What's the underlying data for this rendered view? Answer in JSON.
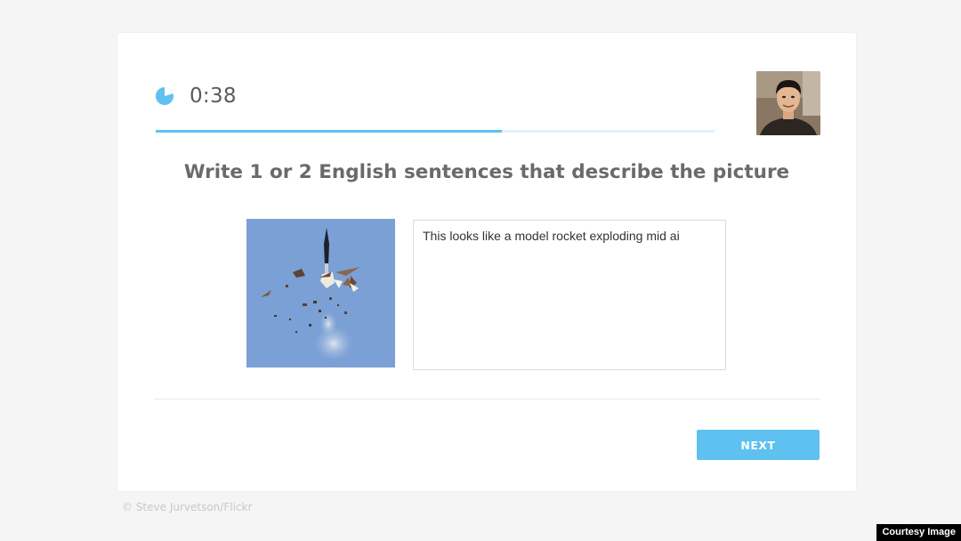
{
  "timer": {
    "remaining": "0:38",
    "progress_fraction": 0.62,
    "icon": "pie-timer-icon"
  },
  "prompt": {
    "text": "Write 1 or 2 English sentences that describe the picture"
  },
  "answer": {
    "value": "This looks like a model rocket exploding mid ai"
  },
  "actions": {
    "next_label": "NEXT"
  },
  "footer": {
    "photo_credit": "© Steve Jurvetson/Flickr",
    "courtesy_label": "Courtesy Image"
  },
  "colors": {
    "accent": "#5ec1ef",
    "progress_track": "#dff3fc",
    "text": "#6a6a6a",
    "background": "#f5f5f5"
  }
}
